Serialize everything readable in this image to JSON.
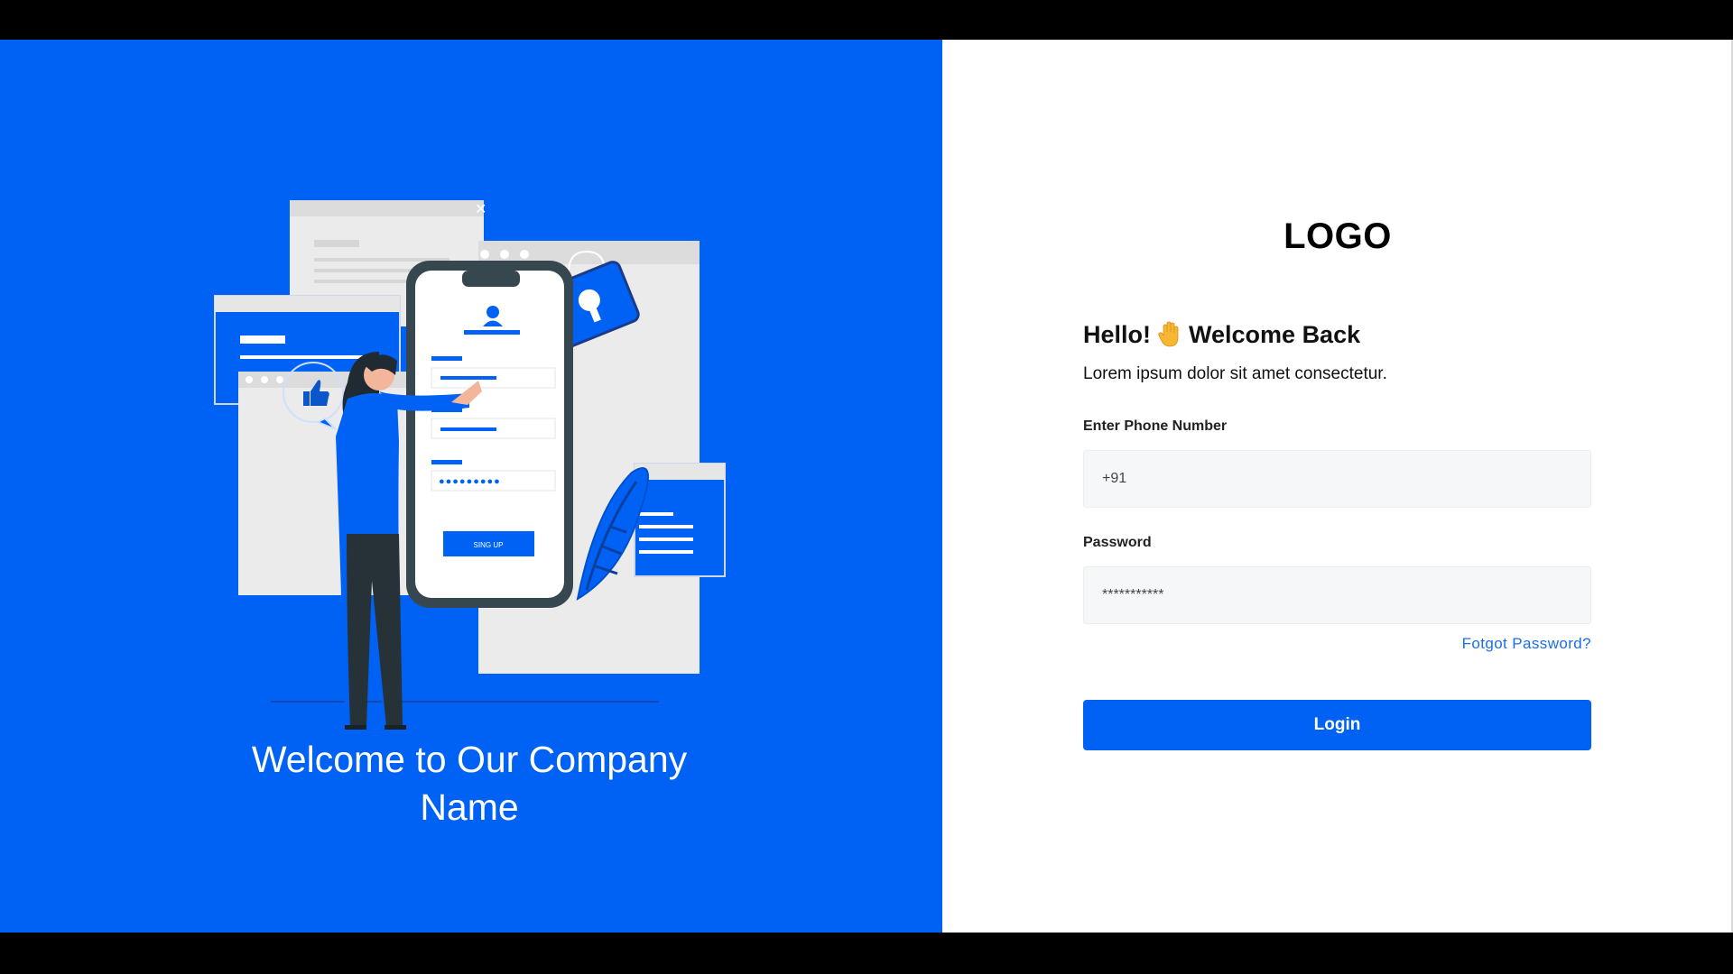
{
  "hero": {
    "title": "Welcome to Our Company Name",
    "illustration": {
      "button_label": "SING UP"
    }
  },
  "login": {
    "logo": "LOGO",
    "greeting": {
      "prefix": "Hello!",
      "icon": "waving-hand-icon",
      "suffix": "Welcome Back"
    },
    "subtitle": "Lorem ipsum dolor sit amet consectetur.",
    "phone": {
      "label": "Enter Phone Number",
      "value": "+91"
    },
    "password": {
      "label": "Password",
      "value": "***********"
    },
    "forgot_label": "Fotgot Password?",
    "submit_label": "Login"
  },
  "colors": {
    "brand_blue": "#0062f5",
    "link_blue": "#1a6fe8",
    "input_bg": "#f6f7f9"
  }
}
